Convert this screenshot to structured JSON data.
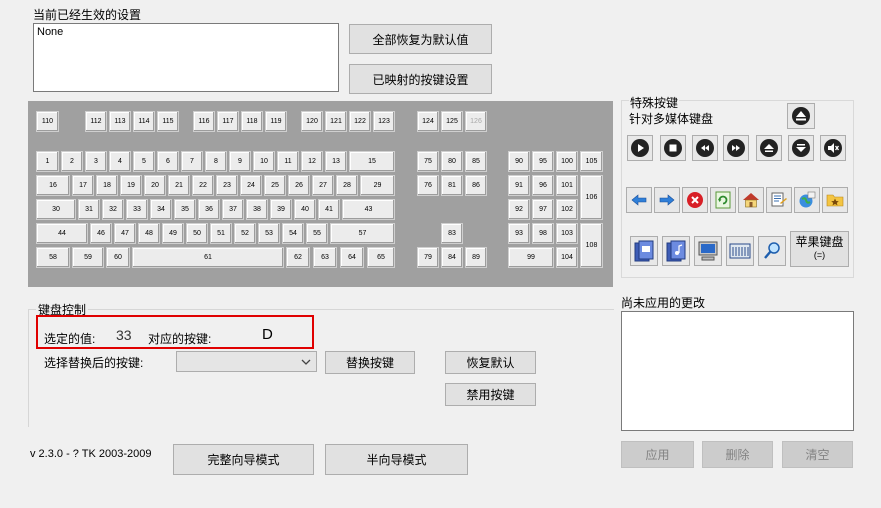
{
  "current_settings": {
    "title": "当前已经生效的设置",
    "value": "None"
  },
  "buttons": {
    "restore_all": "全部恢复为默认值",
    "mapped_settings": "已映射的按键设置",
    "replace_key": "替换按键",
    "restore_default": "恢复默认",
    "disable_key": "禁用按键",
    "full_wizard": "完整向导模式",
    "half_wizard": "半向导模式",
    "apply": "应用",
    "delete": "删除",
    "clear": "清空"
  },
  "special_keys": {
    "title": "特殊按键",
    "subtitle": "针对多媒体键盘",
    "apple_keyboard": "苹果键盘",
    "apple_keyboard_sub": "(=)"
  },
  "keyboard_control": {
    "title": "键盘控制",
    "selected_value_label": "选定的值:",
    "selected_value": "33",
    "mapped_key_label": "对应的按键:",
    "mapped_key": "D",
    "replace_label": "选择替换后的按键:",
    "replace_value": ""
  },
  "pending": {
    "title": "尚未应用的更改"
  },
  "version": "v 2.3.0 - ? TK 2003-2009",
  "keys": {
    "k110": "110",
    "k112": "112",
    "k113": "113",
    "k114": "114",
    "k115": "115",
    "k116": "116",
    "k117": "117",
    "k118": "118",
    "k119": "119",
    "k120": "120",
    "k121": "121",
    "k122": "122",
    "k123": "123",
    "k124": "124",
    "k125": "125",
    "k126": "126",
    "k1": "1",
    "k2": "2",
    "k3": "3",
    "k4": "4",
    "k5": "5",
    "k6": "6",
    "k7": "7",
    "k8": "8",
    "k9": "9",
    "k10": "10",
    "k11": "11",
    "k12": "12",
    "k13": "13",
    "k15": "15",
    "k75": "75",
    "k80": "80",
    "k85": "85",
    "k90": "90",
    "k95": "95",
    "k100": "100",
    "k105": "105",
    "k16": "16",
    "k17": "17",
    "k18": "18",
    "k19": "19",
    "k20": "20",
    "k21": "21",
    "k22": "22",
    "k23": "23",
    "k24": "24",
    "k25": "25",
    "k26": "26",
    "k27": "27",
    "k28": "28",
    "k29": "29",
    "k76": "76",
    "k81": "81",
    "k86": "86",
    "k91": "91",
    "k96": "96",
    "k101": "101",
    "k106": "106",
    "k30": "30",
    "k31": "31",
    "k32": "32",
    "k33": "33",
    "k34": "34",
    "k35": "35",
    "k36": "36",
    "k37": "37",
    "k38": "38",
    "k39": "39",
    "k40": "40",
    "k41": "41",
    "k43": "43",
    "k92": "92",
    "k97": "97",
    "k102": "102",
    "k44": "44",
    "k46": "46",
    "k47": "47",
    "k48": "48",
    "k49": "49",
    "k50": "50",
    "k51": "51",
    "k52": "52",
    "k53": "53",
    "k54": "54",
    "k55": "55",
    "k57": "57",
    "k83": "83",
    "k93": "93",
    "k98": "98",
    "k103": "103",
    "k108": "108",
    "k58": "58",
    "k59": "59",
    "k60": "60",
    "k61": "61",
    "k62": "62",
    "k63": "63",
    "k64": "64",
    "k65": "65",
    "k79": "79",
    "k84": "84",
    "k89": "89",
    "k99": "99",
    "k104": "104"
  }
}
